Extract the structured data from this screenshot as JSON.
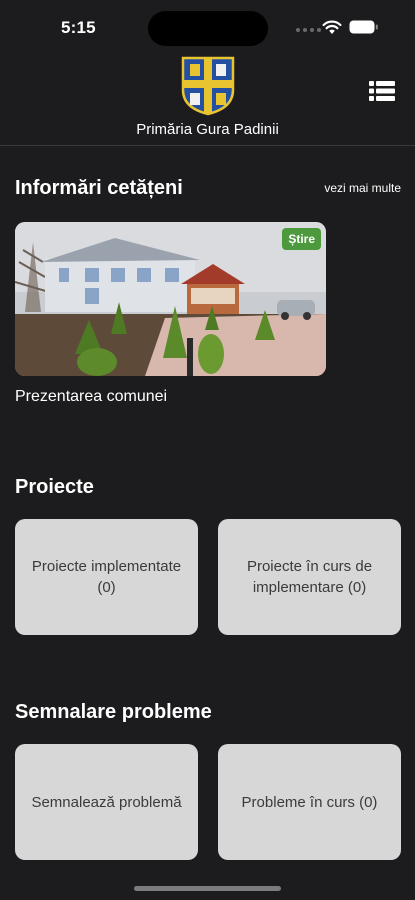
{
  "status_bar": {
    "time": "5:15"
  },
  "header": {
    "title": "Primăria Gura Padinii",
    "menu_icon": "list-icon",
    "logo_icon": "coat-of-arms"
  },
  "news_section": {
    "title": "Informări cetățeni",
    "see_more": "vezi mai multe",
    "items": [
      {
        "badge": "Știre",
        "caption": "Prezentarea comunei"
      }
    ]
  },
  "projects_section": {
    "title": "Proiecte",
    "tiles": [
      {
        "label": "Proiecte implementate (0)"
      },
      {
        "label": "Proiecte în curs de implementare (0)"
      }
    ]
  },
  "issues_section": {
    "title": "Semnalare probleme",
    "tiles": [
      {
        "label": "Semnalează problemă"
      },
      {
        "label": "Probleme în curs (0)"
      }
    ]
  },
  "colors": {
    "background": "#1c1b1d",
    "tile": "#d7d7d7",
    "tile_text": "#3b3b3b",
    "badge": "#4c9a3d",
    "coat_blue": "#2350a0",
    "coat_gold": "#e8c430"
  }
}
